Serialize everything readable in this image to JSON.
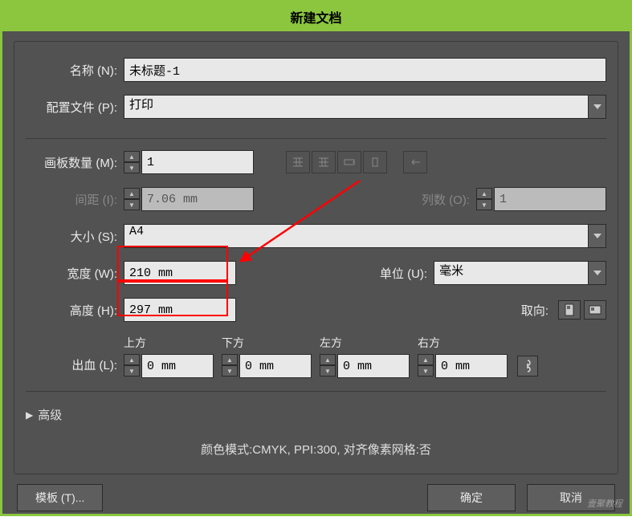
{
  "dialog": {
    "title": "新建文档",
    "name": {
      "label": "名称 (N):",
      "value": "未标题-1"
    },
    "profile": {
      "label": "配置文件 (P):",
      "value": "打印"
    },
    "artboards": {
      "label": "画板数量 (M):",
      "value": "1"
    },
    "spacing": {
      "label": "间距 (I):",
      "value": "7.06 mm"
    },
    "columns": {
      "label": "列数 (O):",
      "value": "1"
    },
    "size": {
      "label": "大小 (S):",
      "value": "A4"
    },
    "width": {
      "label": "宽度 (W):",
      "value": "210 mm"
    },
    "height": {
      "label": "高度 (H):",
      "value": "297 mm"
    },
    "units": {
      "label": "单位 (U):",
      "value": "毫米"
    },
    "orientation": {
      "label": "取向:"
    },
    "bleed": {
      "label": "出血 (L):",
      "top": {
        "label": "上方",
        "value": "0 mm"
      },
      "bottom": {
        "label": "下方",
        "value": "0 mm"
      },
      "left": {
        "label": "左方",
        "value": "0 mm"
      },
      "right": {
        "label": "右方",
        "value": "0 mm"
      }
    },
    "advanced": {
      "label": "高级"
    },
    "info": "颜色模式:CMYK, PPI:300, 对齐像素网格:否",
    "buttons": {
      "template": "模板 (T)...",
      "ok": "确定",
      "cancel": "取消"
    }
  },
  "watermark": "壹聚教程"
}
